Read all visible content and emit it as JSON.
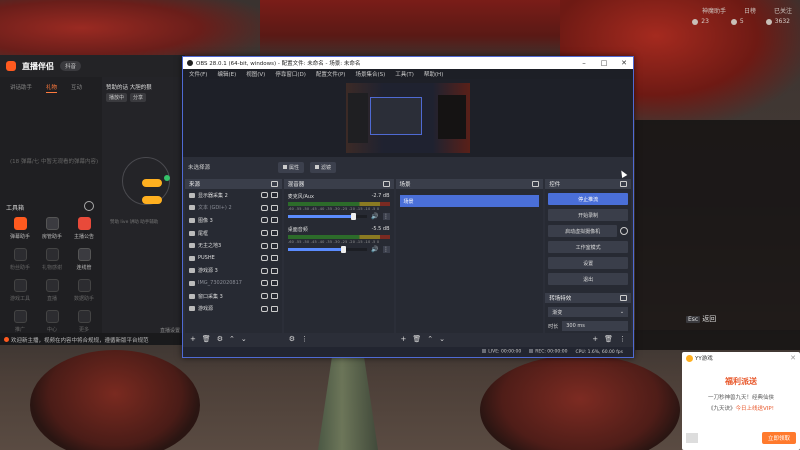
{
  "top_right": {
    "badges": [
      "神魔助手",
      "日榜",
      "已关注"
    ],
    "stats": [
      "23",
      "5",
      "3632"
    ]
  },
  "streamer_app": {
    "title": "直播伴侣",
    "version": "抖音",
    "tabs": [
      "讲话助手",
      "礼物",
      "互动"
    ],
    "empty_hint": "(18 弹幕/七 中暂无观看的弹幕内容)",
    "mid_title": "赞助的话 大胆的狠",
    "mid_badges": [
      "播放中",
      "分享"
    ],
    "mid_hint": "赞助 live 讲助 助手辅助",
    "mid_bottom": "直播设置",
    "tools_title": "工具箱",
    "tools": [
      {
        "label": "弹幕助手",
        "style": "hot"
      },
      {
        "label": "房管助手",
        "style": "normal"
      },
      {
        "label": "主播公告",
        "style": "red"
      },
      {
        "label": "粉丝助手",
        "style": "dim"
      },
      {
        "label": "礼物感谢",
        "style": "dim"
      },
      {
        "label": "连线管",
        "style": "normal"
      },
      {
        "label": "游戏工具",
        "style": "dim"
      },
      {
        "label": "直播",
        "style": "dim"
      },
      {
        "label": "数据助手",
        "style": "dim"
      },
      {
        "label": "推广",
        "style": "dim"
      },
      {
        "label": "中心",
        "style": "dim"
      },
      {
        "label": "更多",
        "style": "dim"
      }
    ],
    "notice": "欢迎新主播，视频在内容中将合规规，遵循新版平台规范"
  },
  "obs": {
    "title": "OBS 28.0.1 (64-bit, windows) - 配置文件: 未命名 - 场景: 未命名",
    "window_controls": [
      "–",
      "□",
      "✕"
    ],
    "menu": [
      "文件(F)",
      "编辑(E)",
      "视图(V)",
      "停靠窗口(D)",
      "配置文件(P)",
      "场景集合(S)",
      "工具(T)",
      "帮助(H)"
    ],
    "no_source": "未选择源",
    "properties_btn": "属性",
    "filters_btn": "滤镜",
    "sources_title": "来源",
    "sources": [
      {
        "name": "显示器采集 2",
        "dim": false
      },
      {
        "name": "文本 (GDI+) 2",
        "dim": true
      },
      {
        "name": "图像 3",
        "dim": false
      },
      {
        "name": "尾框",
        "dim": false
      },
      {
        "name": "无主之地3",
        "dim": false
      },
      {
        "name": "PUSHE",
        "dim": false
      },
      {
        "name": "游戏源 3",
        "dim": false
      },
      {
        "name": "IMG_7302020817",
        "dim": true
      },
      {
        "name": "窗口采集 3",
        "dim": false
      },
      {
        "name": "游戏源",
        "dim": false
      }
    ],
    "mixer_title": "混音器",
    "mixer": [
      {
        "name": "麦克风/Aux",
        "db": "-2.7 dB",
        "level": 0.82
      },
      {
        "name": "桌面音频",
        "db": "-5.5 dB",
        "level": 0.7
      }
    ],
    "meter_ticks": "-60 -55 -50 -45 -40 -35 -30 -25 -20 -15 -10 -5 0",
    "scenes_title": "场景",
    "scenes": [
      "场景"
    ],
    "controls_title": "控件",
    "controls": {
      "stop_stream": "停止推流",
      "start_record": "开始录制",
      "virtual_cam": "启动虚拟摄像机",
      "studio_mode": "工作室模式",
      "settings": "设置",
      "exit": "退出"
    },
    "transitions_title": "转场特效",
    "transition": "渐变",
    "duration_label": "时长",
    "duration": "300 ms",
    "status": {
      "live": "LIVE: 00:00:00",
      "rec": "REC: 00:00:00",
      "cpu": "CPU: 1.6%, 60.00 fps"
    }
  },
  "return_label": "返回",
  "return_key": "Esc",
  "popup": {
    "app_name": "YY游戏",
    "title": "福利派送",
    "line1": "一刀秒神兽九天！经典仙侠",
    "line2_a": "《九天诀》",
    "line2_b": "今日上线送VIP!",
    "button": "立即领取"
  }
}
